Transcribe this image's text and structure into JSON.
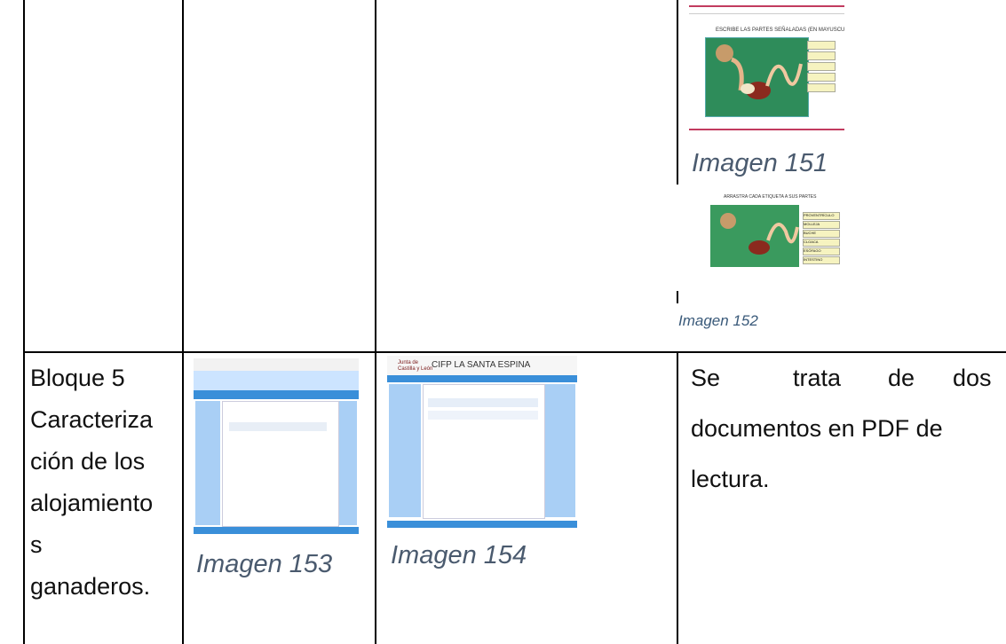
{
  "row2": {
    "block_lines": [
      "Bloque 5",
      "Caracteriza",
      "ción de los",
      "alojamiento",
      "s",
      "ganaderos."
    ],
    "description": {
      "words": [
        "Se",
        "trata",
        "de",
        "dos"
      ],
      "line2": "documentos en PDF de",
      "line3": "lectura."
    }
  },
  "captions": {
    "img151": "Imagen 151",
    "img152": "Imagen 152",
    "img153": "Imagen 153",
    "img154": "Imagen 154"
  },
  "thumb151": {
    "title": "ESCRIBE LAS PARTES SEÑALADAS (EN MAYUSCULAS)"
  },
  "thumb152": {
    "title": "ARRASTRA CADA ETIQUETA A SUS PARTES",
    "labels": [
      "PROVENTRÍCULO",
      "MOLLEJA",
      "BUCHE",
      "CLOACA",
      "ESÓFAGO",
      "INTESTINO"
    ]
  },
  "thumb154": {
    "site_title": "CIFP LA SANTA ESPINA",
    "logo_line1": "Junta de",
    "logo_line2": "Castilla y León"
  },
  "colors": {
    "page_bg": "#ffffff",
    "border": "#000000",
    "caption": "#4a5a6e",
    "site_blue": "#3a8fd9",
    "green_bg": "#2e8c5a"
  }
}
